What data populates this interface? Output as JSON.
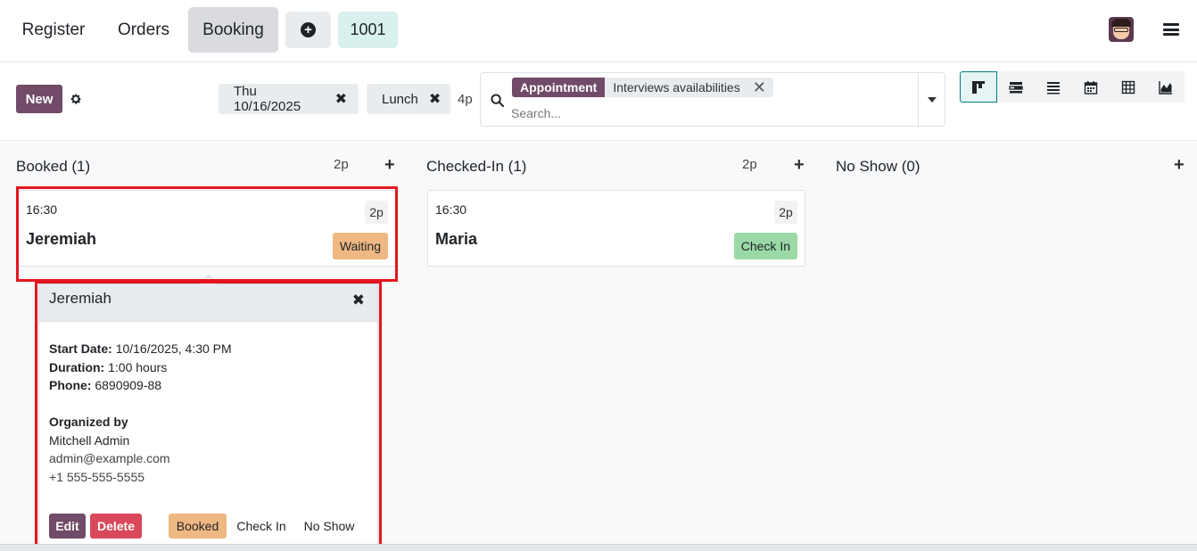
{
  "topbar": {
    "register": "Register",
    "orders": "Orders",
    "booking": "Booking",
    "plus": "+",
    "order_number": "1001"
  },
  "control": {
    "new_label": "New",
    "facets": [
      {
        "label": "Thu 10/16/2025",
        "remove": "✖"
      },
      {
        "label": "Lunch",
        "remove": "✖"
      }
    ],
    "capacity": "4p",
    "search": {
      "tag_label": "Appointment",
      "tag_value": "Interviews availabilities",
      "tag_remove": "✕",
      "placeholder": "Search..."
    },
    "views": [
      "kanban-icon",
      "gantt-icon",
      "list-icon",
      "calendar-icon",
      "pivot-icon",
      "graph-icon"
    ]
  },
  "columns": [
    {
      "title": "Booked (1)",
      "count": "2p",
      "add": "+"
    },
    {
      "title": "Checked-In (1)",
      "count": "2p",
      "add": "+"
    },
    {
      "title": "No Show (0)",
      "add": "+"
    }
  ],
  "cards": [
    {
      "time": "16:30",
      "name": "Jeremiah",
      "people": "2p",
      "status": "Waiting"
    },
    {
      "time": "16:30",
      "name": "Maria",
      "people": "2p",
      "status": "Check In"
    }
  ],
  "popover": {
    "title": "Jeremiah",
    "close": "✖",
    "start_label": "Start Date:",
    "start_value": "10/16/2025, 4:30 PM",
    "duration_label": "Duration:",
    "duration_value": "1:00 hours",
    "phone_label": "Phone:",
    "phone_value": "6890909-88",
    "organized_label": "Organized by",
    "organizer_name": "Mitchell Admin",
    "organizer_email": "admin@example.com",
    "organizer_phone": "+1 555-555-5555",
    "actions": {
      "edit": "Edit",
      "delete": "Delete",
      "booked": "Booked",
      "check_in": "Check In",
      "no_show": "No Show"
    }
  },
  "colors": {
    "brand": "#714b67",
    "waiting": "#efb883",
    "checkin": "#9ad9a6",
    "delete": "#d9485b",
    "annotation": "#e3161f"
  }
}
